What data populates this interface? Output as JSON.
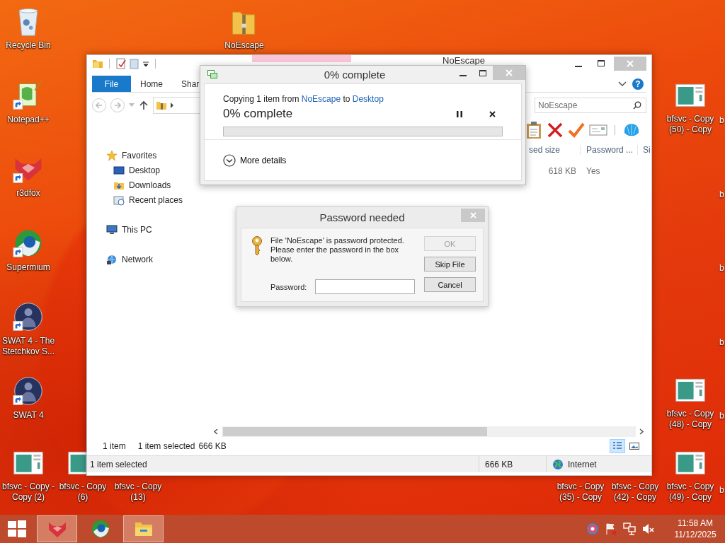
{
  "desktop": {
    "left_column": [
      {
        "label": "Recycle Bin",
        "kind": "recycle",
        "shortcut": false
      },
      {
        "label": "Notepad++",
        "kind": "notepad",
        "shortcut": true
      },
      {
        "label": "r3dfox",
        "kind": "fox",
        "shortcut": true
      },
      {
        "label": "Supermium",
        "kind": "browser",
        "shortcut": true
      },
      {
        "label": "SWAT 4 - The Stetchkov S...",
        "kind": "game",
        "shortcut": true
      },
      {
        "label": "SWAT 4",
        "kind": "game",
        "shortcut": true
      }
    ],
    "top_row": [
      {
        "label": "NoEscape",
        "kind": "zip",
        "shortcut": false
      }
    ],
    "right_column": [
      {
        "label": "bfsvc - Copy (50) - Copy",
        "kind": "window",
        "shortcut": false
      },
      {
        "label": "bfsvc - Copy (48) - Copy",
        "kind": "window",
        "shortcut": false
      }
    ],
    "bottom_row": [
      {
        "label": "bfsvc - Copy - Copy (2)",
        "kind": "window",
        "shortcut": false
      },
      {
        "label": "bfsvc - Copy (6)",
        "kind": "window",
        "shortcut": false
      },
      {
        "label": "bfsvc - Copy (13)"
      },
      {
        "label": "bfsvc - Copy (35) - Copy"
      },
      {
        "label": "bfsvc - Copy (42) - Copy"
      },
      {
        "label": "bfsvc - Copy (49) - Copy",
        "kind": "window",
        "shortcut": false
      }
    ],
    "edge_column": [
      {
        "label": "b"
      },
      {
        "label": "b"
      },
      {
        "label": "b"
      },
      {
        "label": "b"
      },
      {
        "label": "b"
      },
      {
        "label": "b"
      }
    ]
  },
  "explorer": {
    "title": "NoEscape",
    "ribbon_tabs": [
      {
        "label": "File",
        "kind": "file"
      },
      {
        "label": "Home",
        "kind": "tab"
      },
      {
        "label": "Shar",
        "kind": "tab"
      }
    ],
    "help_label": "?",
    "search": {
      "placeholder": "NoEscape"
    },
    "columns": [
      "sed size",
      "Password ...",
      "Si"
    ],
    "row": [
      "618 KB",
      "Yes"
    ],
    "nav": [
      {
        "label": "Favorites",
        "kind": "star",
        "children": [
          {
            "label": "Desktop",
            "kind": "desktop"
          },
          {
            "label": "Downloads",
            "kind": "downloads"
          },
          {
            "label": "Recent places",
            "kind": "recent"
          }
        ]
      },
      {
        "label": "This PC",
        "kind": "pc"
      },
      {
        "label": "Network",
        "kind": "network"
      }
    ],
    "item_count": "1 item",
    "selection": "1 item selected",
    "selection_size": "666 KB",
    "view_buttons": [
      {
        "kind": "details",
        "selected": true
      },
      {
        "kind": "thumbnails",
        "selected": false
      }
    ],
    "status_bar": {
      "text": "1 item selected",
      "size": "666 KB",
      "zone": "Internet"
    }
  },
  "copy_dialog": {
    "title": "0% complete",
    "message": [
      {
        "kind": "text",
        "text": "Copying 1 item from"
      },
      {
        "kind": "link",
        "text": "NoEscape"
      },
      {
        "kind": "text",
        "text": "to"
      },
      {
        "kind": "link",
        "text": "Desktop"
      }
    ],
    "status": "0% complete",
    "level": 0,
    "details": "More details"
  },
  "password_dialog": {
    "title": "Password needed",
    "message": "File 'NoEscape' is password protected. Please enter the password in the box below.",
    "field_label": "Password:",
    "buttons": [
      {
        "label": "OK",
        "disabled": true
      },
      {
        "label": "Skip File",
        "disabled": false
      },
      {
        "label": "Cancel",
        "disabled": false
      }
    ]
  },
  "taskbar": {
    "apps": [
      {
        "kind": "fox",
        "highlighted": true
      },
      {
        "kind": "browser",
        "highlighted": false
      },
      {
        "kind": "explorer",
        "highlighted": true
      }
    ],
    "time": "11:58 AM",
    "date": "11/12/2025"
  }
}
